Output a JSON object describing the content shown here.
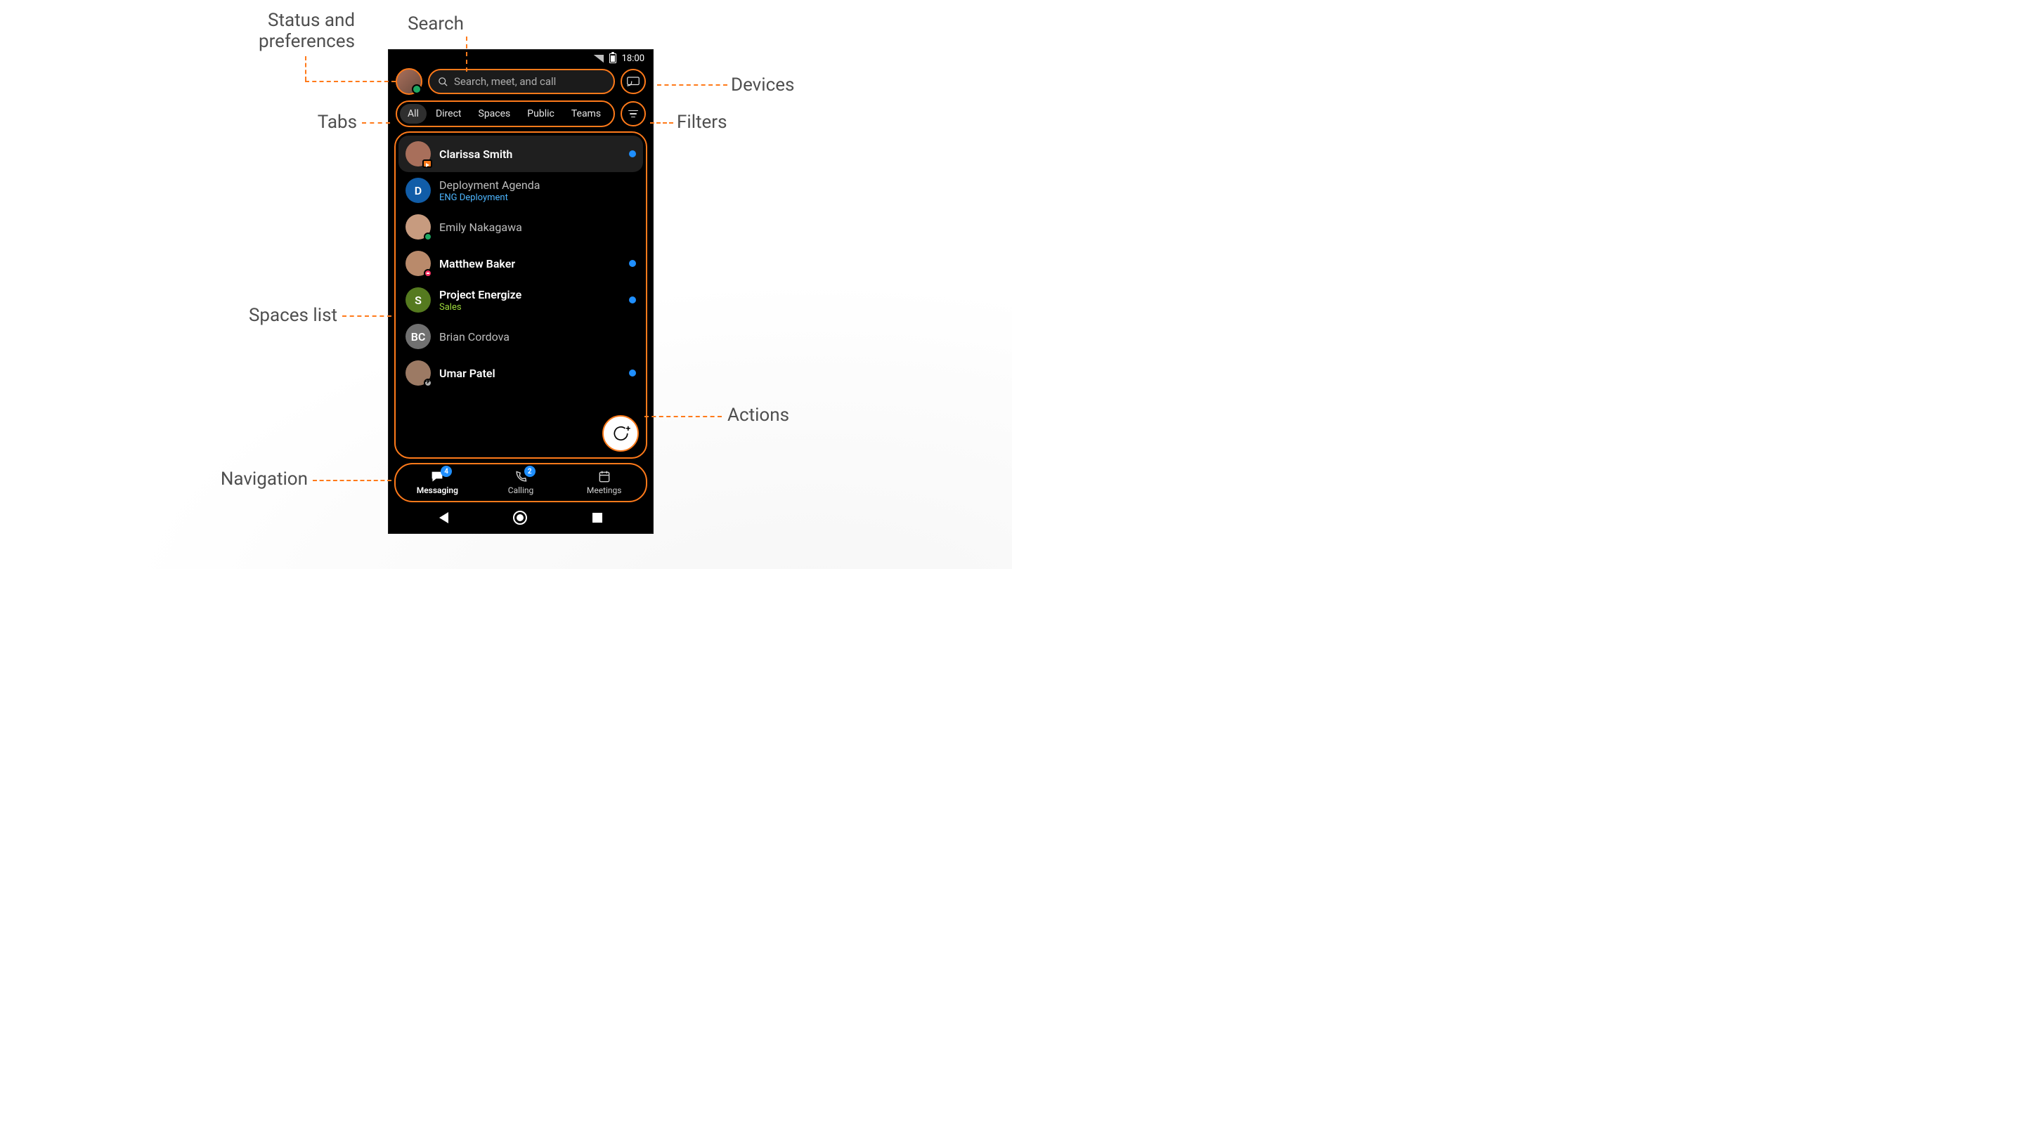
{
  "statusbar": {
    "time": "18:00"
  },
  "header": {
    "search_placeholder": "Search, meet, and call"
  },
  "tabs": {
    "items": [
      "All",
      "Direct",
      "Spaces",
      "Public",
      "Teams"
    ],
    "active_index": 0
  },
  "spaces": [
    {
      "name": "Clarissa Smith",
      "subtitle": "",
      "sub_color": "",
      "avatar": {
        "type": "photo",
        "initials": "",
        "bg": "#a86f5b",
        "presence": "cam"
      },
      "bold": true,
      "unread": true,
      "selected": true
    },
    {
      "name": "Deployment Agenda",
      "subtitle": "ENG Deployment",
      "sub_color": "blue",
      "avatar": {
        "type": "letter",
        "initials": "D",
        "bg": "#115da8",
        "presence": ""
      },
      "bold": false,
      "unread": false,
      "selected": false
    },
    {
      "name": "Emily Nakagawa",
      "subtitle": "",
      "sub_color": "",
      "avatar": {
        "type": "photo",
        "initials": "",
        "bg": "#c79b7f",
        "presence": "green"
      },
      "bold": false,
      "unread": false,
      "selected": false
    },
    {
      "name": "Matthew Baker",
      "subtitle": "",
      "sub_color": "",
      "avatar": {
        "type": "photo",
        "initials": "",
        "bg": "#b98a6b",
        "presence": "dnd"
      },
      "bold": true,
      "unread": true,
      "selected": false
    },
    {
      "name": "Project Energize",
      "subtitle": "Sales",
      "sub_color": "green",
      "avatar": {
        "type": "letter",
        "initials": "S",
        "bg": "#557a1f",
        "presence": ""
      },
      "bold": true,
      "unread": true,
      "selected": false
    },
    {
      "name": "Brian Cordova",
      "subtitle": "",
      "sub_color": "",
      "avatar": {
        "type": "letter",
        "initials": "BC",
        "bg": "#707070",
        "presence": ""
      },
      "bold": false,
      "unread": false,
      "selected": false
    },
    {
      "name": "Umar Patel",
      "subtitle": "",
      "sub_color": "",
      "avatar": {
        "type": "photo",
        "initials": "",
        "bg": "#9c7a64",
        "presence": "plane"
      },
      "bold": true,
      "unread": true,
      "selected": false
    }
  ],
  "nav": {
    "items": [
      {
        "label": "Messaging",
        "badge": 4,
        "active": true
      },
      {
        "label": "Calling",
        "badge": 2,
        "active": false
      },
      {
        "label": "Meetings",
        "badge": 0,
        "active": false
      }
    ]
  },
  "callouts": {
    "status_prefs": "Status and preferences",
    "search": "Search",
    "devices": "Devices",
    "tabs": "Tabs",
    "filters": "Filters",
    "spaces_list": "Spaces list",
    "actions": "Actions",
    "navigation": "Navigation"
  }
}
